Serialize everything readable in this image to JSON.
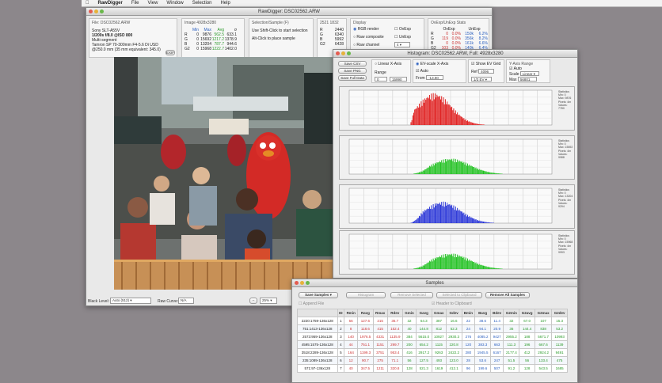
{
  "menubar": {
    "apple": "",
    "app": "RawDigger",
    "items": [
      "File",
      "View",
      "Window",
      "Selection",
      "Help"
    ]
  },
  "main_window": {
    "title": "RawDigger: DSC02562.ARW",
    "file_panel": {
      "header": "File: DSC02562.ARW",
      "lines": [
        "Sony SLT-A55V",
        "1/200s f/8.0 @ISO 800",
        "Multi-segment",
        "Tamron SP 70-300mm F4-5.6 Di USD",
        "@250.0 mm (35 mm equivalent: 345.0)"
      ],
      "exif_button": "EXIF"
    },
    "image_panel": {
      "header": "Image 4928x3280",
      "cols": [
        "",
        "Min",
        "Max",
        "Avg",
        "σ"
      ],
      "rows": [
        [
          "R",
          "0",
          "9876",
          "562.5",
          "633.1"
        ],
        [
          "G",
          "0",
          "15692",
          "1217.2",
          "1378.9"
        ],
        [
          "B",
          "0",
          "13204",
          "787.7",
          "944.6"
        ],
        [
          "G2",
          "0",
          "15968",
          "1222.7",
          "1402.0"
        ]
      ]
    },
    "selection_panel": {
      "header": "Selection/Sample (F)",
      "lines": [
        "Use Shift-Click to start selection",
        "Alt-Click to place sample"
      ]
    },
    "coords_panel": {
      "header": "2521 1832",
      "rows": [
        [
          "R",
          "2440"
        ],
        [
          "G",
          "6340"
        ],
        [
          "B",
          "5992"
        ],
        [
          "G2",
          "6428"
        ]
      ]
    },
    "display_panel": {
      "header": "Display",
      "options": [
        "RGB render",
        "Raw composite",
        "Raw channel"
      ],
      "checks": [
        "OvExp",
        "UnExp"
      ],
      "channel": "4"
    },
    "ovexp_panel": {
      "header": "OvExp/UnExp Stats",
      "cols": [
        "OvExp",
        "UnExp"
      ],
      "rows": [
        [
          "R",
          "0",
          "0.0%",
          "150k",
          "6.2%"
        ],
        [
          "G",
          "119",
          "0.0%",
          "356k",
          "8.2%"
        ],
        [
          "B",
          "0",
          "0.0%",
          "161k",
          "6.6%"
        ],
        [
          "G2",
          "103",
          "0.0%",
          "140k",
          "6.4%"
        ]
      ]
    },
    "footer": {
      "black_label": "Black Level:",
      "black_value": "Auto (512)",
      "curve_label": "Raw Curve:",
      "curve_value": "N/A",
      "zoom": "25%"
    }
  },
  "histogram_window": {
    "title": "Histogram: DSC02562.ARW, Full: 4928x3280",
    "buttons": [
      "Save CSV",
      "Save PNG",
      "Save Full Data"
    ],
    "linear_x": "Linear X-Axis",
    "range_label": "Range",
    "range_from": "0",
    "range_to": "15990",
    "ev_scale": "EV-scale X-Axis",
    "auto_label": "Auto",
    "from_label": "From",
    "from_val": "-13.80",
    "show_grid": "Show EV Grid",
    "ref_label": "Ref",
    "ref_val": "4096",
    "ev_step": "1/3 EV",
    "yaxis_header": "Y-Axis Range",
    "yaxis_auto": "Auto",
    "scale_label": "Scale",
    "scale_val": "Linear",
    "max_label": "Max",
    "max_val": "56801",
    "charts": [
      {
        "stats": [
          "Statistics",
          "Min: 0",
          "Max: 9876",
          "Pixels: 4m",
          "Values: 7780"
        ],
        "color": "#e02020"
      },
      {
        "stats": [
          "Statistics",
          "Min: 0",
          "Max: 15692",
          "Pixels: 4m",
          "Values: 9988"
        ],
        "color": "#22c222"
      },
      {
        "stats": [
          "Statistics",
          "Min: 0",
          "Max: 13204",
          "Pixels: 4m",
          "Values: 9294"
        ],
        "color": "#2a36d8"
      },
      {
        "stats": [
          "Statistics",
          "Min: 0",
          "Max: 15968",
          "Pixels: 4m",
          "Values: 9993"
        ],
        "color": "#22c222"
      }
    ]
  },
  "samples_window": {
    "title": "Samples",
    "buttons": [
      "Save Samples",
      "Histogram",
      "Remove Selected",
      "Selected to Clipboard",
      "Remove All Samples"
    ],
    "append": "Append File",
    "header_clip": "Header to Clipboard",
    "columns": [
      "",
      "ID",
      "Rmin",
      "Ravg",
      "Rmax",
      "Rdev",
      "Gmin",
      "Gavg",
      "Gmax",
      "Gdev",
      "Bmin",
      "Bavg",
      "Bdev",
      "G2min",
      "G2avg",
      "G2max",
      "G2dev"
    ],
    "rows": [
      [
        "2220:1759-136x128",
        "1",
        "56",
        "127.6",
        "215",
        "36.7",
        "32",
        "64.3",
        "387",
        "16.6",
        "22",
        "38.6",
        "11.4",
        "32",
        "67.0",
        "107",
        "15.3"
      ],
      [
        "751:1413-136x128",
        "2",
        "8",
        "118.6",
        "415",
        "152.4",
        "40",
        "144.8",
        "812",
        "52.3",
        "24",
        "94.1",
        "20.9",
        "36",
        "144.4",
        "838",
        "53.2"
      ],
      [
        "2573:959-136x128",
        "3",
        "140",
        "1976.5",
        "4331",
        "1135.9",
        "384",
        "5615.0",
        "10927",
        "2930.3",
        "276",
        "4085.2",
        "9427",
        "2955.2",
        "188",
        "5671.7",
        "10993",
        "2955.2"
      ],
      [
        "4595:1575-136x128",
        "4",
        "44",
        "751.1",
        "1151",
        "299.7",
        "200",
        "654.2",
        "1115",
        "220.8",
        "120",
        "383.3",
        "663",
        "111.3",
        "196",
        "667.6",
        "1139",
        "220.9"
      ],
      [
        "3518:2289-136x128",
        "5",
        "164",
        "1199.3",
        "3751",
        "953.4",
        "416",
        "2917.2",
        "9263",
        "2422.2",
        "280",
        "1945.5",
        "6167",
        "2177.4",
        "412",
        "2924.2",
        "9491",
        "2452.6"
      ],
      [
        "235:1089-136x128",
        "6",
        "12",
        "90.7",
        "275",
        "71.1",
        "56",
        "127.5",
        "493",
        "123.0",
        "28",
        "53.6",
        "247",
        "51.5",
        "56",
        "133.4",
        "475",
        "116.4"
      ],
      [
        "571:97-136x128",
        "7",
        "40",
        "347.5",
        "1211",
        "320.8",
        "128",
        "521.3",
        "1619",
        "412.1",
        "96",
        "199.6",
        "507",
        "91.2",
        "128",
        "543.5",
        "1685",
        "427.2"
      ]
    ]
  }
}
